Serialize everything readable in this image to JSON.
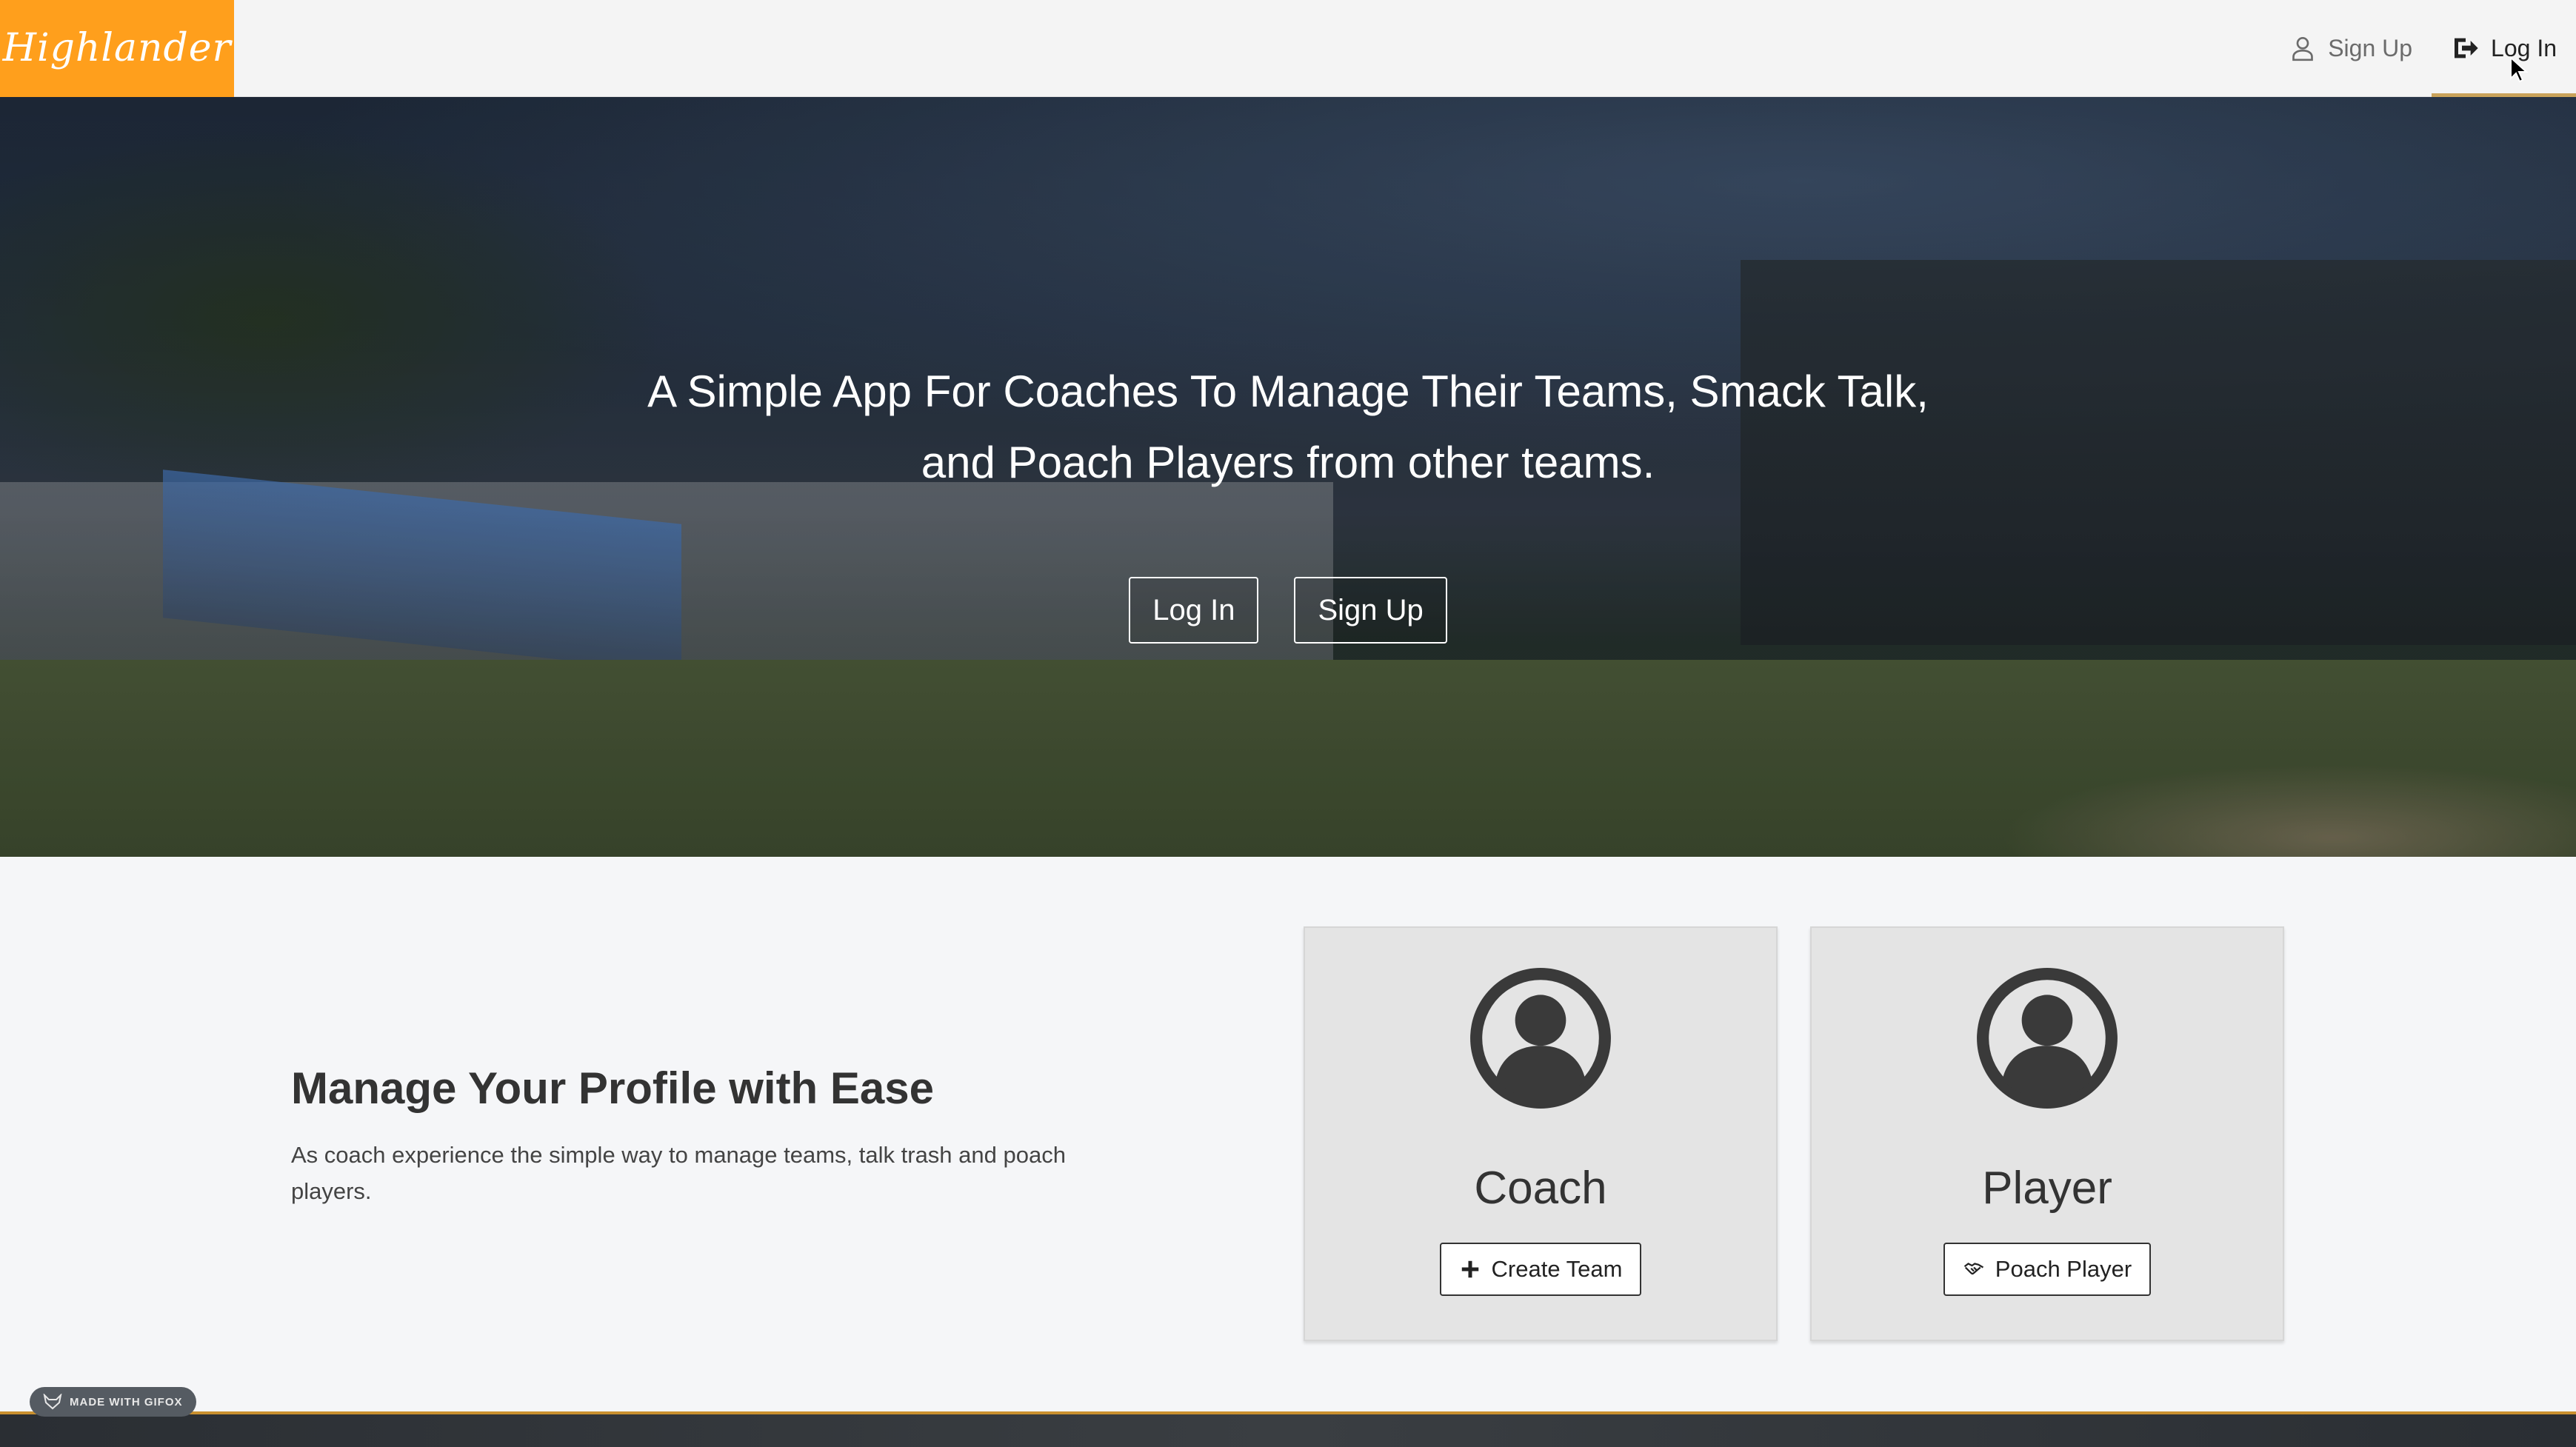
{
  "navbar": {
    "brand": "Highlander",
    "sign_up_label": "Sign Up",
    "log_in_label": "Log In",
    "brand_color": "#ff9f1c"
  },
  "hero": {
    "title_line1": "A Simple App For Coaches To Manage Their Teams, Smack Talk,",
    "title_line2": "and Poach Players from other teams.",
    "log_in_button": "Log In",
    "sign_up_button": "Sign Up"
  },
  "feature": {
    "title": "Manage Your Profile with Ease",
    "description": "As coach experience the simple way to manage teams, talk trash and poach players."
  },
  "cards": {
    "coach": {
      "title": "Coach",
      "button_label": "Create Team",
      "button_icon": "plus-icon",
      "avatar_icon": "user-circle-icon"
    },
    "player": {
      "title": "Player",
      "button_label": "Poach Player",
      "button_icon": "handshake-icon",
      "avatar_icon": "user-circle-icon"
    }
  },
  "watermark": {
    "label": "MADE WITH GIFOX"
  },
  "colors": {
    "accent_underline": "#c9a25a",
    "page_background": "#f5f6f8",
    "card_background": "#e4e4e4"
  }
}
